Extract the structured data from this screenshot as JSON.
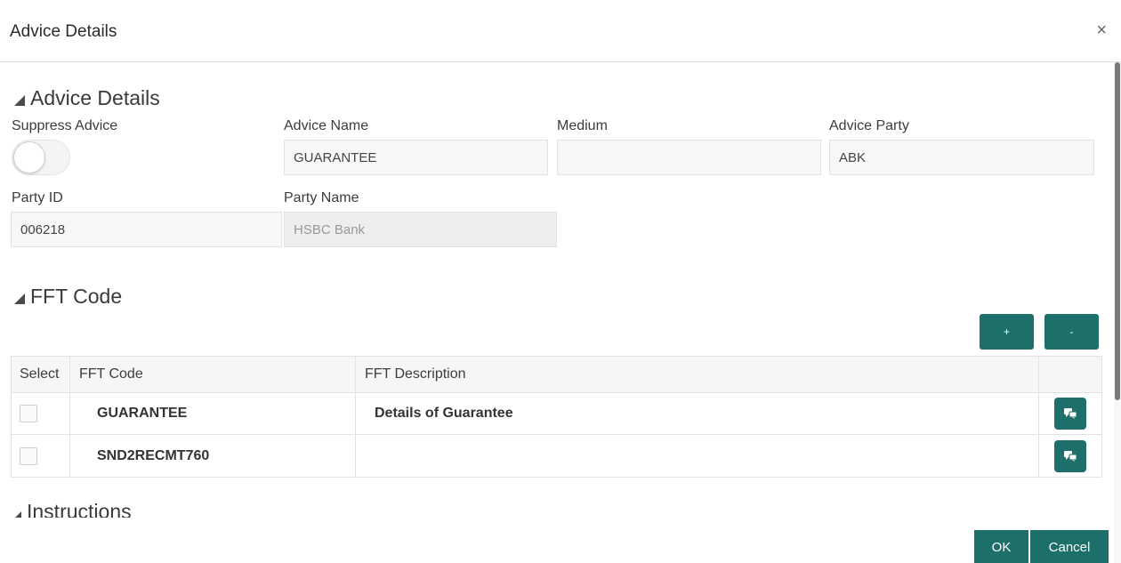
{
  "dialog": {
    "title": "Advice Details",
    "close_icon": "×"
  },
  "advice_section": {
    "title": "Advice Details",
    "suppress_advice": {
      "label": "Suppress Advice",
      "checked": false
    },
    "advice_name": {
      "label": "Advice Name",
      "value": "GUARANTEE"
    },
    "medium": {
      "label": "Medium",
      "value": ""
    },
    "advice_party": {
      "label": "Advice Party",
      "value": "ABK"
    },
    "party_id": {
      "label": "Party ID",
      "value": "006218"
    },
    "party_name": {
      "label": "Party Name",
      "value": "HSBC Bank"
    }
  },
  "fft_section": {
    "title": "FFT Code",
    "add_label": "+",
    "remove_label": "-",
    "columns": [
      "Select",
      "FFT Code",
      "FFT Description"
    ],
    "rows": [
      {
        "code": "GUARANTEE",
        "description": "Details  of Guarantee"
      },
      {
        "code": "SND2RECMT760",
        "description": ""
      }
    ]
  },
  "instructions_section": {
    "title": "Instructions"
  },
  "footer": {
    "ok_label": "OK",
    "cancel_label": "Cancel"
  },
  "colors": {
    "accent": "#1d6f6a"
  }
}
